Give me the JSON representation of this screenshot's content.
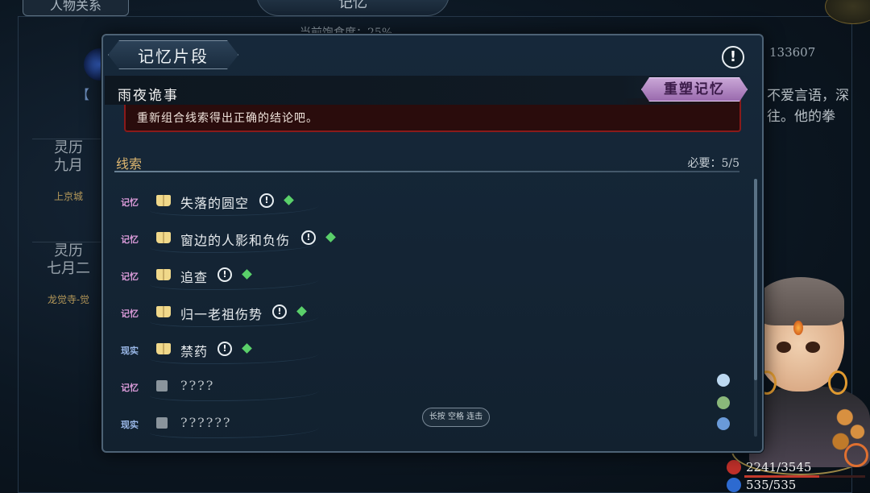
{
  "background": {
    "tab_left": "人物关系",
    "tab_center": "记忆",
    "progress_text": "当前饱食度：25%",
    "id_text": "133607",
    "right_text_line1": "不爱言语，深",
    "right_text_line2": "往。他的拳",
    "bracket_text": "【",
    "cards": [
      {
        "line1": "灵历",
        "line2": "九月",
        "location": "上京城"
      },
      {
        "line1": "灵历",
        "line2": "七月二",
        "location": "龙觉寺-觉"
      }
    ],
    "hp": {
      "current": 2241,
      "max": 3545,
      "text": "2241/3545"
    },
    "mp": {
      "current": 535,
      "max": 535,
      "text": "535/535"
    }
  },
  "panel": {
    "title": "记忆片段",
    "info_icon": "!",
    "memory_name": "雨夜诡事",
    "reshape_button": "重塑记忆",
    "hint": "重新组合线索得出正确的结论吧。",
    "clues_title": "线索",
    "required": "必要：5/5",
    "hold_button": "长按 空格 连击",
    "clues": [
      {
        "tag": "记忆",
        "type": "memory",
        "label": "失落的圆空",
        "unlocked": true
      },
      {
        "tag": "记忆",
        "type": "memory",
        "label": "窗边的人影和负伤",
        "unlocked": true
      },
      {
        "tag": "记忆",
        "type": "memory",
        "label": "追查",
        "unlocked": true
      },
      {
        "tag": "记忆",
        "type": "memory",
        "label": "归一老祖伤势",
        "unlocked": true
      },
      {
        "tag": "现实",
        "type": "reality",
        "label": "禁药",
        "unlocked": true
      },
      {
        "tag": "记忆",
        "type": "memory",
        "label": "????",
        "unlocked": false
      },
      {
        "tag": "现实",
        "type": "reality",
        "label": "??????",
        "unlocked": false
      }
    ]
  },
  "colors": {
    "accent_gold": "#e0b870",
    "memory_tag": "#d99ad8",
    "reality_tag": "#9ab8e8",
    "gem_green": "#5ad06a",
    "hint_border": "#8a1a1a",
    "reshape_button": "#b690c6"
  }
}
